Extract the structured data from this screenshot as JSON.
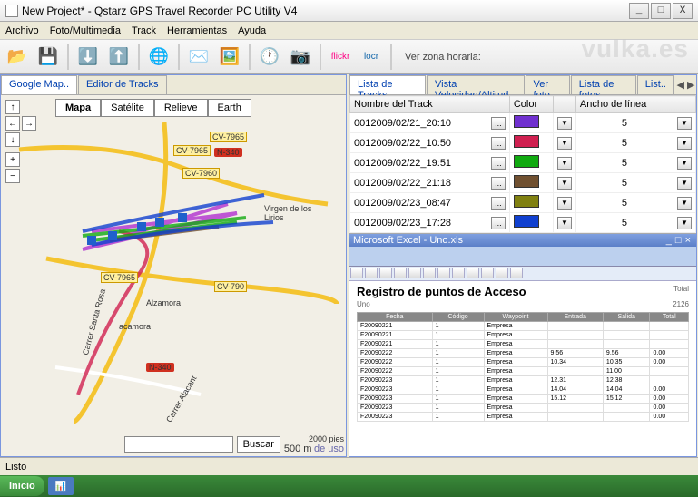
{
  "window": {
    "title": "New Project* - Qstarz GPS Travel Recorder PC Utility V4"
  },
  "menu": {
    "archivo": "Archivo",
    "foto": "Foto/Multimedia",
    "track": "Track",
    "herramientas": "Herramientas",
    "ayuda": "Ayuda"
  },
  "toolbar": {
    "zona": "Ver zona horaria:"
  },
  "leftTabs": {
    "google": "Google Map..",
    "editor": "Editor de Tracks"
  },
  "rightTabs": {
    "lista": "Lista de Tracks..",
    "vista": "Vista Velocidad/Altitud",
    "verfoto": "Ver foto",
    "listafotos": "Lista de fotos",
    "list": "List.."
  },
  "mapTypes": {
    "mapa": "Mapa",
    "satelite": "Satélite",
    "relieve": "Relieve",
    "earth": "Earth"
  },
  "mapLabels": {
    "cv7965a": "CV-7965",
    "cv7965b": "CV-7965",
    "cv7960": "CV-7960",
    "cv7965c": "CV-7965",
    "cv790": "CV-790",
    "n340a": "N-340",
    "n340b": "N-340",
    "alzamora": "Alzamora",
    "acamora": "acamora",
    "virgen": "Virgen de los Lirios",
    "santarosa": "Carrer Santa Rosa",
    "alacant": "Carrer Alacant"
  },
  "search": {
    "placeholder": "",
    "button": "Buscar"
  },
  "scale": {
    "feet": "2000 pies",
    "meters": "500 m",
    "terms": "de uso"
  },
  "trackTable": {
    "headers": {
      "name": "Nombre del Track",
      "color": "Color",
      "width": "Ancho de línea"
    },
    "rows": [
      {
        "name": "0012009/02/21_20:10",
        "color": "#7030d0",
        "width": "5"
      },
      {
        "name": "0012009/02/22_10:50",
        "color": "#d02050",
        "width": "5"
      },
      {
        "name": "0012009/02/22_19:51",
        "color": "#10aa10",
        "width": "5"
      },
      {
        "name": "0012009/02/22_21:18",
        "color": "#705030",
        "width": "5"
      },
      {
        "name": "0012009/02/23_08:47",
        "color": "#808010",
        "width": "5"
      },
      {
        "name": "0012009/02/23_17:28",
        "color": "#1040d0",
        "width": "5"
      }
    ]
  },
  "excel": {
    "titlebar": "Microsoft Excel - Uno.xls",
    "heading": "Registro de puntos de Acceso",
    "sub": "Uno",
    "total": "Total",
    "totalnum": "2126",
    "cols": {
      "fecha": "Fecha",
      "codigo": "Código",
      "waypoint": "Waypoint",
      "entrada": "Entrada",
      "salida": "Salida",
      "totalc": "Total"
    },
    "rows": [
      [
        "F20090221",
        "1",
        "Empresa",
        "",
        "",
        ""
      ],
      [
        "F20090221",
        "1",
        "Empresa",
        "",
        "",
        ""
      ],
      [
        "F20090221",
        "1",
        "Empresa",
        "",
        "",
        ""
      ],
      [
        "F20090222",
        "1",
        "Empresa",
        "9.56",
        "9.56",
        "0.00"
      ],
      [
        "F20090222",
        "1",
        "Empresa",
        "10.34",
        "10.35",
        "0.00"
      ],
      [
        "F20090222",
        "1",
        "Empresa",
        "",
        "11.00",
        ""
      ],
      [
        "F20090223",
        "1",
        "Empresa",
        "12.31",
        "12.38",
        ""
      ],
      [
        "F20090223",
        "1",
        "Empresa",
        "14.04",
        "14.04",
        "0.00"
      ],
      [
        "F20090223",
        "1",
        "Empresa",
        "15.12",
        "15.12",
        "0.00"
      ],
      [
        "F20090223",
        "1",
        "Empresa",
        "",
        "",
        "0.00"
      ],
      [
        "F20090223",
        "1",
        "Empresa",
        "",
        "",
        "0.00"
      ]
    ]
  },
  "status": {
    "text": "Listo"
  },
  "taskbar": {
    "start": "Inicio"
  },
  "watermark": "vulka.es"
}
